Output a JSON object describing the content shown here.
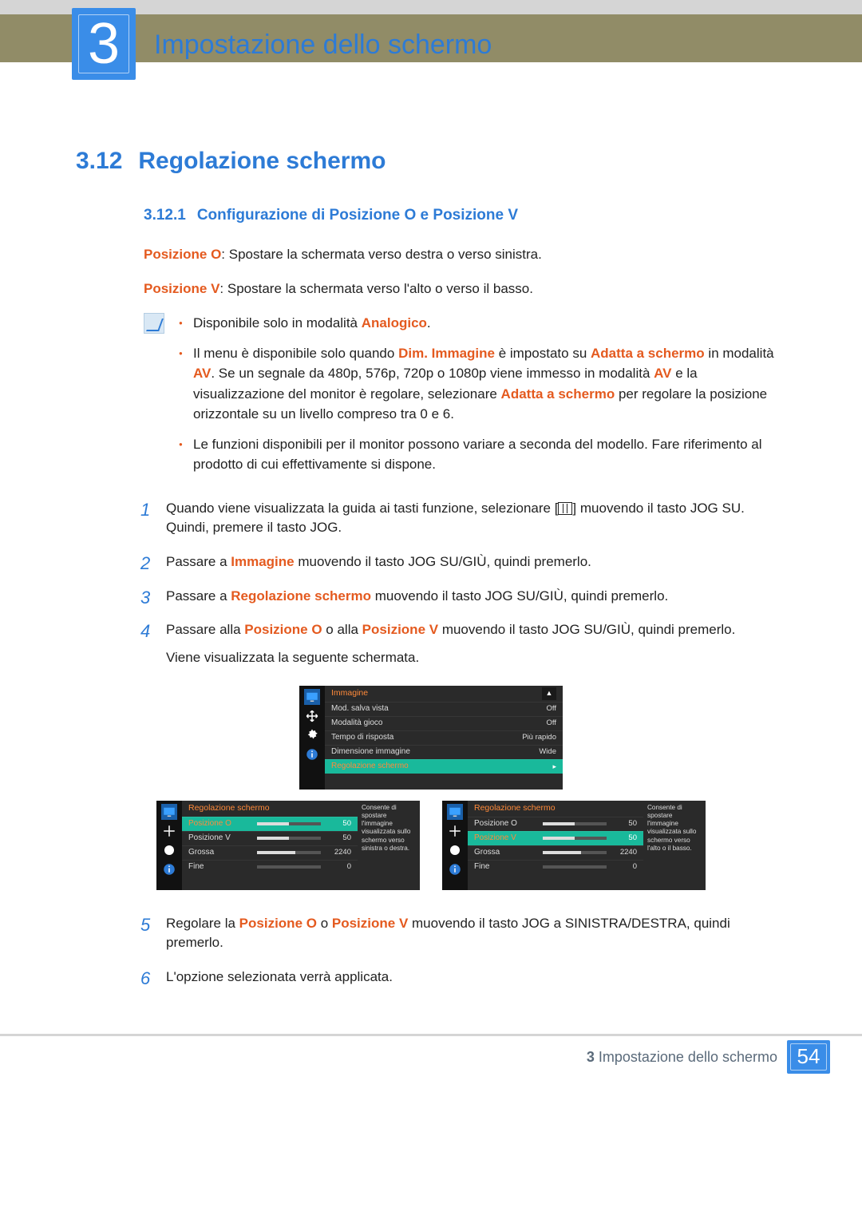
{
  "chapter": {
    "number": "3",
    "title": "Impostazione dello schermo"
  },
  "section": {
    "number": "3.12",
    "title": "Regolazione schermo"
  },
  "subsection": {
    "number": "3.12.1",
    "title": "Configurazione di Posizione O e Posizione V"
  },
  "defs": {
    "posO_label": "Posizione O",
    "posO_text": ": Spostare la schermata verso destra o verso sinistra.",
    "posV_label": "Posizione V",
    "posV_text": ": Spostare la schermata verso l'alto o verso il basso."
  },
  "notes": {
    "n1_a": "Disponibile solo in modalità ",
    "n1_hl": "Analogico",
    "n1_b": ".",
    "n2_a": "Il menu è disponibile solo quando ",
    "n2_hl1": "Dim. Immagine",
    "n2_b": " è impostato su ",
    "n2_hl2": "Adatta a schermo",
    "n2_c": " in modalità ",
    "n2_hl3": "AV",
    "n2_d": ". Se un segnale da 480p, 576p, 720p o 1080p viene immesso in modalità ",
    "n2_hl4": "AV",
    "n2_e": " e la visualizzazione del monitor è regolare, selezionare ",
    "n2_hl5": "Adatta a schermo",
    "n2_f": " per regolare la posizione orizzontale su un livello compreso tra 0 e 6.",
    "n3": "Le funzioni disponibili per il monitor possono variare a seconda del modello. Fare riferimento al prodotto di cui effettivamente si dispone."
  },
  "steps": {
    "s1_a": "Quando viene visualizzata la guida ai tasti funzione, selezionare [",
    "s1_b": "] muovendo il tasto JOG SU. Quindi, premere il tasto JOG.",
    "s2_a": "Passare a ",
    "s2_hl": "Immagine",
    "s2_b": " muovendo il tasto JOG SU/GIÙ, quindi premerlo.",
    "s3_a": "Passare a ",
    "s3_hl": "Regolazione schermo",
    "s3_b": " muovendo il tasto JOG SU/GIÙ, quindi premerlo.",
    "s4_a": "Passare alla ",
    "s4_hl1": "Posizione O",
    "s4_b": " o alla ",
    "s4_hl2": "Posizione V",
    "s4_c": " muovendo il tasto JOG SU/GIÙ, quindi premerlo.",
    "s4_d": "Viene visualizzata la seguente schermata.",
    "s5_a": "Regolare la ",
    "s5_hl1": "Posizione O",
    "s5_b": " o ",
    "s5_hl2": "Posizione V",
    "s5_c": " muovendo il tasto JOG a SINISTRA/DESTRA, quindi premerlo.",
    "s6": "L'opzione selezionata verrà applicata."
  },
  "step_nums": {
    "1": "1",
    "2": "2",
    "3": "3",
    "4": "4",
    "5": "5",
    "6": "6"
  },
  "osd_top": {
    "title": "Immagine",
    "rows": [
      {
        "label": "Mod. salva vista",
        "value": "Off"
      },
      {
        "label": "Modalità gioco",
        "value": "Off"
      },
      {
        "label": "Tempo di risposta",
        "value": "Più rapido"
      },
      {
        "label": "Dimensione immagine",
        "value": "Wide"
      }
    ],
    "sel": {
      "label": "Regolazione schermo"
    }
  },
  "osd_left": {
    "title": "Regolazione schermo",
    "sel": {
      "label": "Posizione O",
      "value": "50"
    },
    "rows": [
      {
        "label": "Posizione V",
        "value": "50"
      },
      {
        "label": "Grossa",
        "value": "2240"
      },
      {
        "label": "Fine",
        "value": "0"
      }
    ],
    "tip": "Consente di spostare l'immagine visualizzata sullo schermo verso sinistra o destra."
  },
  "osd_right": {
    "title": "Regolazione schermo",
    "rows_before": [
      {
        "label": "Posizione O",
        "value": "50"
      }
    ],
    "sel": {
      "label": "Posizione V",
      "value": "50"
    },
    "rows_after": [
      {
        "label": "Grossa",
        "value": "2240"
      },
      {
        "label": "Fine",
        "value": "0"
      }
    ],
    "tip": "Consente di spostare l'immagine visualizzata sullo schermo verso l'alto o il basso."
  },
  "footer": {
    "label_prefix": "3",
    "label_text": "Impostazione dello schermo",
    "page": "54"
  }
}
